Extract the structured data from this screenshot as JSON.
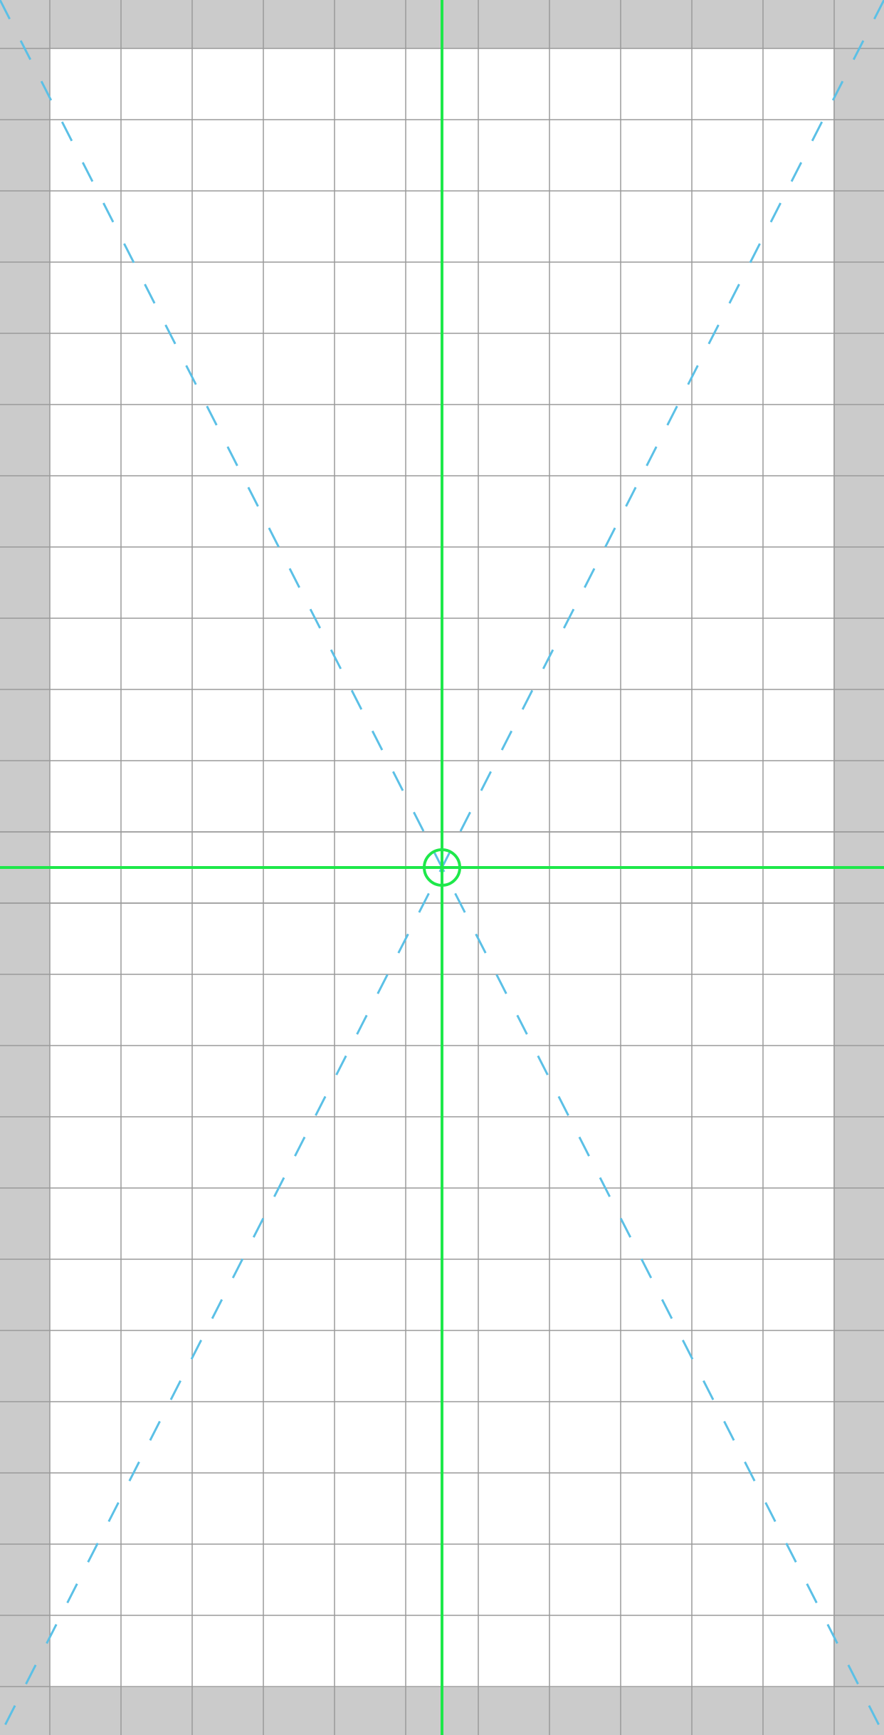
{
  "colors": {
    "outer_margin": "#cbcbcb",
    "safe_area": "#ffffff",
    "grid_line": "#9a9a9a",
    "center_crosshair": "#1ee84a",
    "diagonal_guides": "#5bc0e6"
  },
  "guides": {
    "center_marker_icon": "crosshair-circle-icon",
    "diagonals": "dashed"
  }
}
